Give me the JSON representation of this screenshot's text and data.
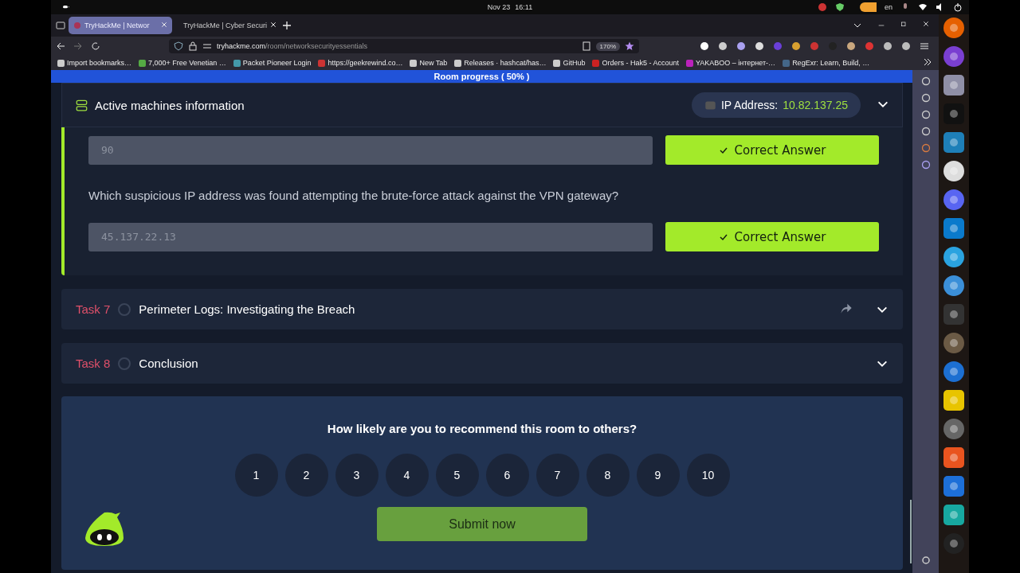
{
  "system_bar": {
    "date": "Nov 23",
    "time": "16:11",
    "language": "en"
  },
  "tabs": [
    {
      "title": "TryHackMe | Networ",
      "selected": true
    },
    {
      "title": "TryHackMe | Cyber Securi",
      "selected": false
    }
  ],
  "address_bar": {
    "domain": "tryhackme.com",
    "path": "/room/networksecurityessentials",
    "zoom": "170%"
  },
  "bookmarks": [
    "Import bookmarks…",
    "7,000+ Free Venetian …",
    "Packet Pioneer Login",
    "https://geekrewind.co…",
    "New Tab",
    "Releases · hashcat/has…",
    "GitHub",
    "Orders - Hak5 - Account",
    "YAKABOO – інтернет-…",
    "RegExr: Learn, Build, …"
  ],
  "progress": {
    "label": "Room progress ( 50% )"
  },
  "machines": {
    "title": "Active machines information",
    "ip_label": "IP Address:",
    "ip": "10.82.137.25"
  },
  "questions": [
    {
      "answer": "90",
      "button": "Correct Answer"
    },
    {
      "question": "Which suspicious IP address was found attempting the brute-force attack against the VPN gateway?",
      "answer": "45.137.22.13",
      "button": "Correct Answer"
    }
  ],
  "tasks": [
    {
      "label": "Task 7",
      "title": "Perimeter Logs: Investigating the Breach",
      "completed": false,
      "share": true
    },
    {
      "label": "Task 8",
      "title": "Conclusion",
      "completed": false,
      "share": false
    }
  ],
  "rating": {
    "question": "How likely are you to recommend this room to others?",
    "options": [
      "1",
      "2",
      "3",
      "4",
      "5",
      "6",
      "7",
      "8",
      "9",
      "10"
    ],
    "submit": "Submit now"
  }
}
